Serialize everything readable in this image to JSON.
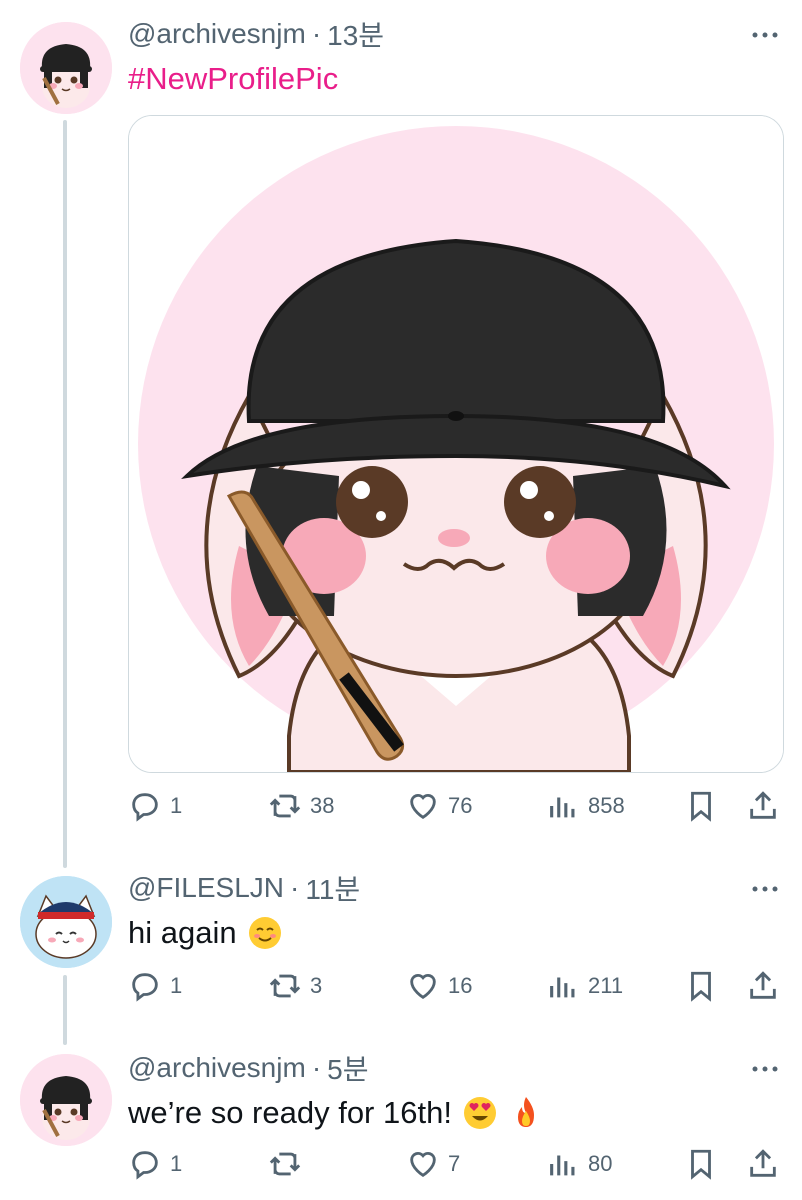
{
  "tweets": [
    {
      "handle": "@archivesnjm",
      "separator": "·",
      "time": "13분",
      "text": "#NewProfilePic",
      "counts": {
        "reply": "1",
        "retweet": "38",
        "like": "76",
        "views": "858"
      }
    },
    {
      "handle": "@FILESLJN",
      "separator": "·",
      "time": "11분",
      "text": "hi again",
      "emoji": "smiling-face-icon",
      "counts": {
        "reply": "1",
        "retweet": "3",
        "like": "16",
        "views": "211"
      }
    },
    {
      "handle": "@archivesnjm",
      "separator": "·",
      "time": "5분",
      "text": "we’re so ready for 16th!",
      "emojis": [
        "heart-eyes-icon",
        "fire-icon"
      ],
      "counts": {
        "reply": "1",
        "retweet": "",
        "like": "7",
        "views": "80"
      }
    }
  ],
  "colors": {
    "hashtag": "#e91e8a",
    "meta": "#536471",
    "thread_line": "#cfd9de"
  }
}
